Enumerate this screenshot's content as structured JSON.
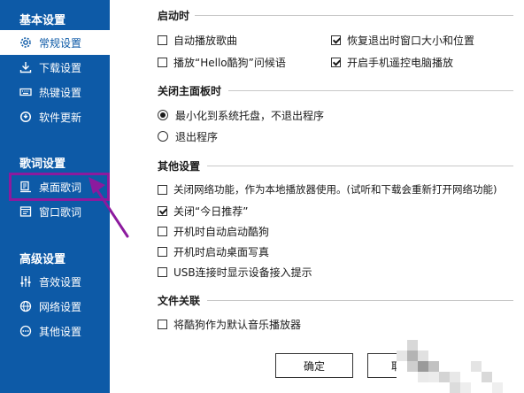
{
  "sidebar": {
    "groups": [
      {
        "title": "基本设置",
        "items": [
          {
            "label": "常规设置",
            "icon": "gear-icon",
            "active": true
          },
          {
            "label": "下载设置",
            "icon": "download-icon",
            "active": false
          },
          {
            "label": "热键设置",
            "icon": "keyboard-icon",
            "active": false
          },
          {
            "label": "软件更新",
            "icon": "refresh-icon",
            "active": false
          }
        ]
      },
      {
        "title": "歌词设置",
        "items": [
          {
            "label": "桌面歌词",
            "icon": "desktop-lyrics-icon",
            "active": false
          },
          {
            "label": "窗口歌词",
            "icon": "window-lyrics-icon",
            "active": false
          }
        ]
      },
      {
        "title": "高级设置",
        "items": [
          {
            "label": "音效设置",
            "icon": "equalizer-icon",
            "active": false
          },
          {
            "label": "网络设置",
            "icon": "globe-icon",
            "active": false
          },
          {
            "label": "其他设置",
            "icon": "more-icon",
            "active": false
          }
        ]
      }
    ]
  },
  "sections": {
    "startup": {
      "title": "启动时",
      "options": [
        {
          "label": "自动播放歌曲",
          "checked": false
        },
        {
          "label": "恢复退出时窗口大小和位置",
          "checked": true
        },
        {
          "label": "播放“Hello酷狗”问候语",
          "checked": false
        },
        {
          "label": "开启手机遥控电脑播放",
          "checked": true
        }
      ]
    },
    "close_panel": {
      "title": "关闭主面板时",
      "options": [
        {
          "label": "最小化到系统托盘，不退出程序",
          "selected": true
        },
        {
          "label": "退出程序",
          "selected": false
        }
      ]
    },
    "other": {
      "title": "其他设置",
      "options": [
        {
          "label": "关闭网络功能，作为本地播放器使用。(试听和下载会重新打开网络功能)",
          "checked": false
        },
        {
          "label": "关闭“今日推荐”",
          "checked": true
        },
        {
          "label": "开机时自动启动酷狗",
          "checked": false
        },
        {
          "label": "开机时启动桌面写真",
          "checked": false
        },
        {
          "label": "USB连接时显示设备接入提示",
          "checked": false
        }
      ]
    },
    "file_assoc": {
      "title": "文件关联",
      "options": [
        {
          "label": "将酷狗作为默认音乐播放器",
          "checked": false
        }
      ]
    }
  },
  "buttons": {
    "confirm": "确定",
    "cancel_partial": "取"
  },
  "colors": {
    "sidebar_bg": "#0d5aa7",
    "highlight": "#8c1a9e"
  }
}
